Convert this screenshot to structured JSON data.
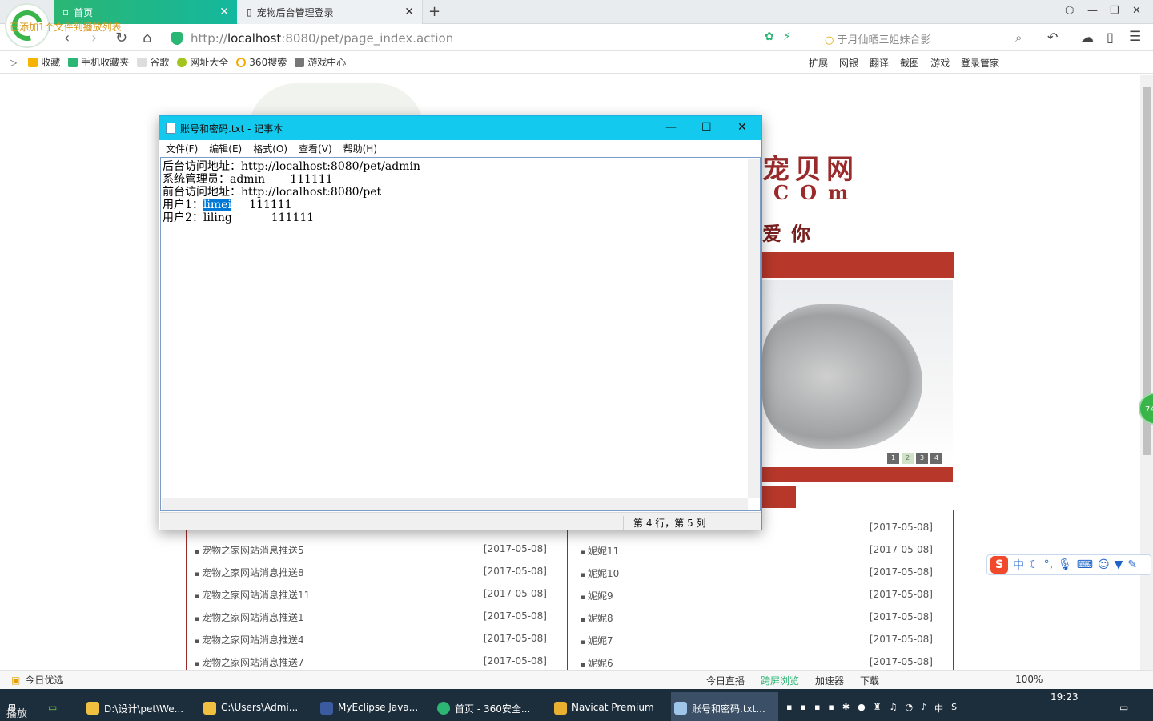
{
  "browser": {
    "caption": "已添加1个文件到播放列表",
    "tabs": [
      {
        "label": "首页"
      },
      {
        "label": "宠物后台管理登录"
      }
    ],
    "url_scheme": "http://",
    "url_host": "localhost",
    "url_path": ":8080/pet/page_index.action",
    "search_hint": "于月仙晒三姐妹合影",
    "bookmarks": [
      "收藏",
      "手机收藏夹",
      "谷歌",
      "网址大全",
      "360搜索",
      "游戏中心"
    ],
    "toolbar_right": [
      "扩展",
      "网银",
      "翻译",
      "截图",
      "游戏",
      "登录管家"
    ]
  },
  "site": {
    "title": "宠贝网",
    "subtitle": "COm",
    "slogan": "爱你",
    "slider_pages": [
      "1",
      "2",
      "3",
      "4"
    ],
    "left_news": [
      {
        "title": "宠物之家网站消息推送5",
        "date": "[2017-05-08]"
      },
      {
        "title": "宠物之家网站消息推送8",
        "date": "[2017-05-08]"
      },
      {
        "title": "宠物之家网站消息推送11",
        "date": "[2017-05-08]"
      },
      {
        "title": "宠物之家网站消息推送1",
        "date": "[2017-05-08]"
      },
      {
        "title": "宠物之家网站消息推送4",
        "date": "[2017-05-08]"
      },
      {
        "title": "宠物之家网站消息推送7",
        "date": "[2017-05-08]"
      }
    ],
    "right_news": [
      {
        "title": "",
        "date": "[2017-05-08]"
      },
      {
        "title": "妮妮11",
        "date": "[2017-05-08]"
      },
      {
        "title": "妮妮10",
        "date": "[2017-05-08]"
      },
      {
        "title": "妮妮9",
        "date": "[2017-05-08]"
      },
      {
        "title": "妮妮8",
        "date": "[2017-05-08]"
      },
      {
        "title": "妮妮7",
        "date": "[2017-05-08]"
      },
      {
        "title": "妮妮6",
        "date": "[2017-05-08]"
      }
    ]
  },
  "ime": {
    "logo": "S",
    "mode": "中"
  },
  "float_badge": "74",
  "statusbar": {
    "left": "今日优选",
    "right": [
      "今日直播",
      "跨屏浏览",
      "加速器",
      "下载",
      "100%"
    ]
  },
  "taskbar": {
    "items": [
      "D:\\设计\\pet\\We...",
      "C:\\Users\\Admi...",
      "MyEclipse Java...",
      "首页 - 360安全...",
      "Navicat Premium",
      "账号和密码.txt..."
    ],
    "clock": "19:23",
    "overlay": "播放"
  },
  "notepad": {
    "title": "账号和密码.txt - 记事本",
    "menu": [
      "文件(F)",
      "编辑(E)",
      "格式(O)",
      "查看(V)",
      "帮助(H)"
    ],
    "lines": {
      "l1": "后台访问地址：http://localhost:8080/pet/admin",
      "l2": "系统管理员：admin       111111",
      "l3": "前台访问地址：http://localhost:8080/pet",
      "l4_prefix": "用户1：",
      "l4_selected": "limei",
      "l4_suffix": "     111111",
      "l5": "用户2：liling           111111"
    },
    "status": "第 4 行，第 5 列"
  },
  "colors": {
    "browser_accent": "#2bb673",
    "site_red": "#b7382b",
    "notepad_title": "#13c9ed",
    "selection": "#0078d7"
  },
  "icons": [
    "back-icon",
    "forward-icon",
    "refresh-icon",
    "home-icon",
    "shield-icon",
    "search-icon",
    "close-icon",
    "minimize-icon",
    "maximize-icon",
    "notepad-doc-icon"
  ]
}
